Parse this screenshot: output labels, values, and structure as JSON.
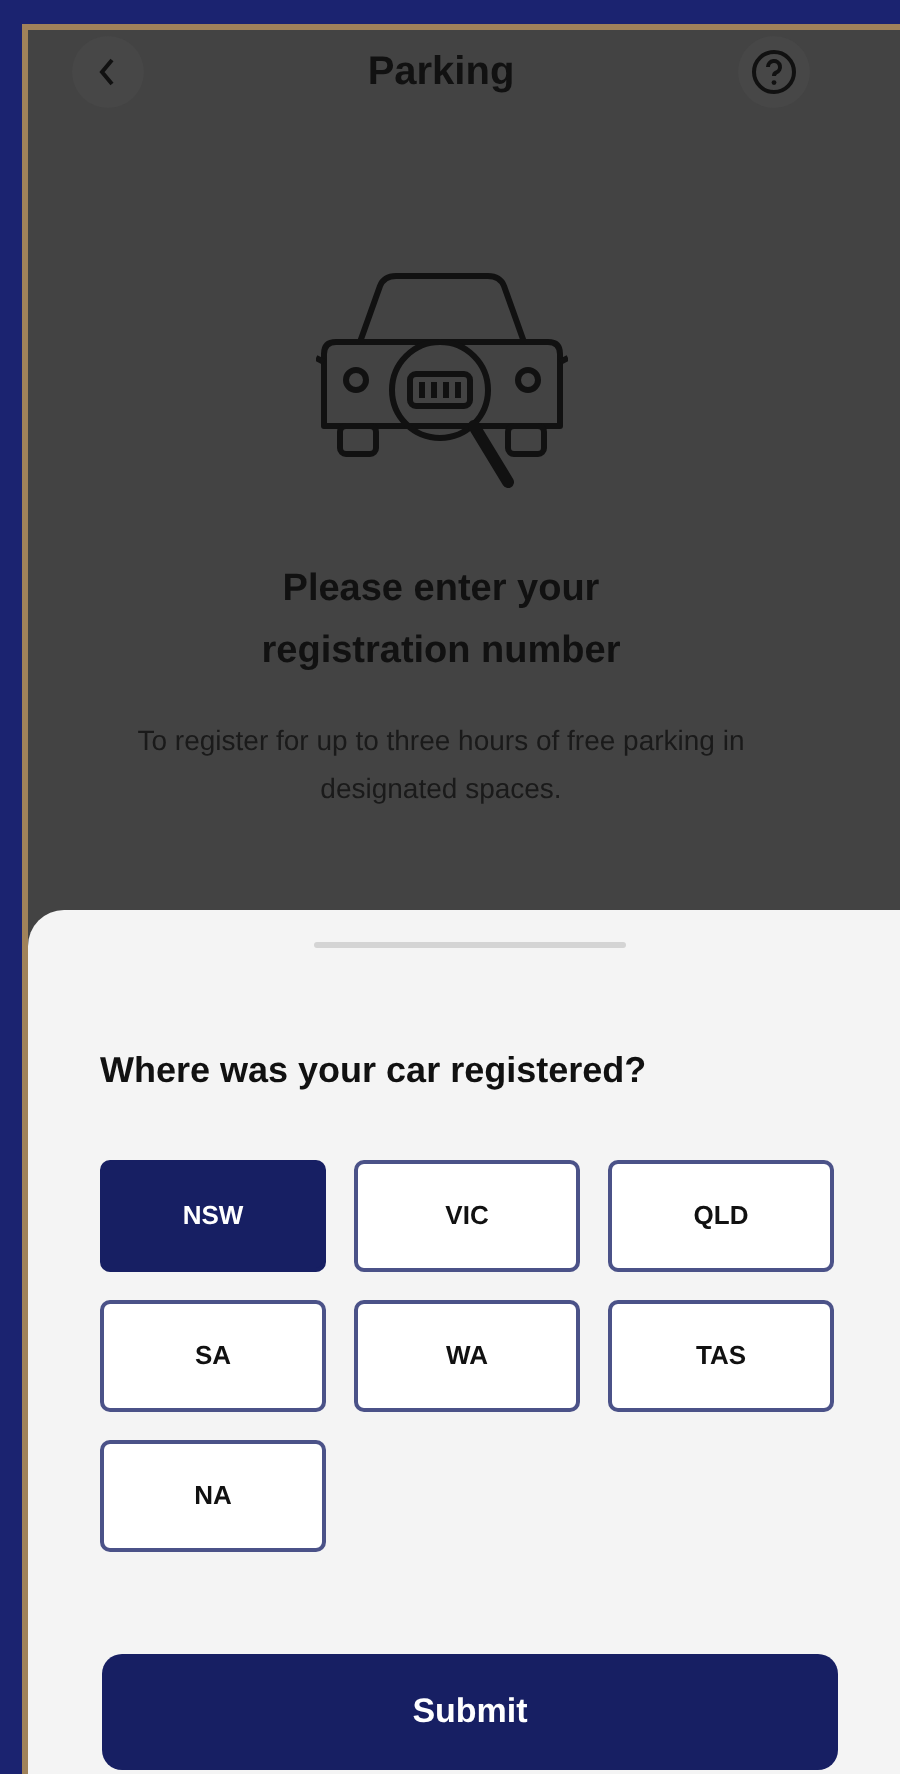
{
  "header": {
    "title": "Parking"
  },
  "intro": {
    "heading": "Please enter your registration number",
    "description": "To register for up to three hours of free parking in designated spaces."
  },
  "sheet": {
    "question": "Where was your car registered?",
    "states": [
      {
        "label": "NSW",
        "selected": true
      },
      {
        "label": "VIC",
        "selected": false
      },
      {
        "label": "QLD",
        "selected": false
      },
      {
        "label": "SA",
        "selected": false
      },
      {
        "label": "WA",
        "selected": false
      },
      {
        "label": "TAS",
        "selected": false
      },
      {
        "label": "NA",
        "selected": false
      }
    ],
    "submit": "Submit"
  }
}
